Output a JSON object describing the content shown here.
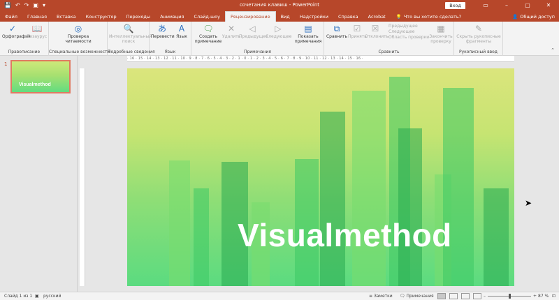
{
  "window": {
    "title": "сочетания клавиш  -  PowerPoint",
    "signin": "Вход",
    "minimize": "–",
    "restore": "▢",
    "close": "✕"
  },
  "qat": {
    "save": "💾",
    "undo": "↶",
    "redo": "↷",
    "customize": "▾"
  },
  "tabs": [
    "Файл",
    "Главная",
    "Вставка",
    "Конструктор",
    "Переходы",
    "Анимация",
    "Слайд-шоу",
    "Рецензирование",
    "Вид",
    "Надстройки",
    "Справка",
    "Acrobat"
  ],
  "active_tab": "Рецензирование",
  "tell_me": "Что вы хотите сделать?",
  "share": "Общий доступ",
  "ribbon": {
    "groups": {
      "proofing": "Правописание",
      "accessibility": "Специальные возможности",
      "insights": "Подробные сведения",
      "language": "Язык",
      "comments": "Примечания",
      "compare": "Сравнить",
      "ink": "Рукописный ввод"
    },
    "buttons": {
      "spelling": "Орфография",
      "thesaurus": "Тезаурус",
      "check_access_1": "Проверка",
      "check_access_2": "читаемости",
      "smart_lookup_1": "Интеллектуальный",
      "smart_lookup_2": "поиск",
      "translate": "Перевести",
      "language": "Язык",
      "new_comment_1": "Создать",
      "new_comment_2": "примечание",
      "delete": "Удалить",
      "previous": "Предыдущее",
      "next": "Следующее",
      "show_comments_1": "Показать",
      "show_comments_2": "примечания",
      "compare": "Сравнить",
      "accept": "Принять",
      "reject": "Отклонить",
      "prev_change": "Предыдущее",
      "next_change": "Следующее",
      "reviewing_pane": "Область проверки",
      "end_review_1": "Закончить",
      "end_review_2": "проверку",
      "hide_ink_1": "Скрыть рукописные",
      "hide_ink_2": "фрагменты"
    }
  },
  "thumbnail": {
    "number": "1",
    "text": "Visualmethod"
  },
  "ruler_labels": "· 16 · 15 · 14 · 13 · 12 · 11 · 10 · 9 · 8 · 7 · 6 · 5 · 4 · 3 · 2 · 1 · 0 · 1 · 2 · 3 · 4 · 5 · 6 · 7 · 8 · 9 · 10 · 11 · 12 · 13 · 14 · 15 · 16 ·",
  "slide": {
    "title": "Visualmethod"
  },
  "status": {
    "slide_info": "Слайд 1 из 1",
    "language": "русский",
    "notes": "Заметки",
    "comments": "Примечания",
    "zoom": "87 %"
  }
}
